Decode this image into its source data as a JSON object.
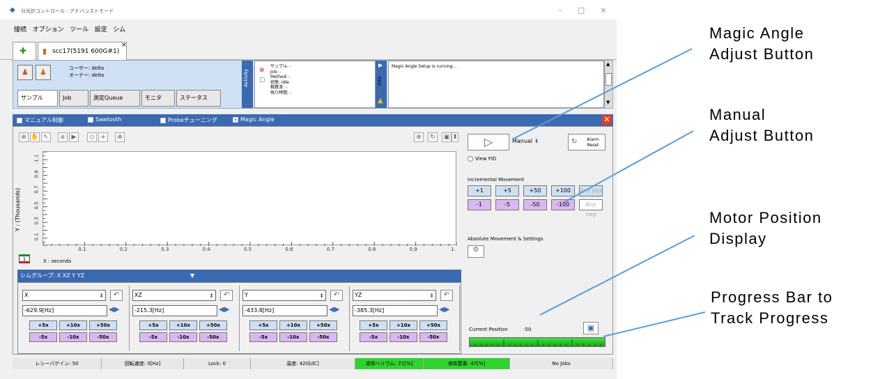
{
  "window": {
    "title": "分光計コントロール - アドバンストモード",
    "controls": [
      "–",
      "□",
      "×"
    ]
  },
  "menu": [
    "接続",
    "オプション",
    "ツール",
    "設定",
    "シム"
  ],
  "connection_tab": {
    "label": "scc17(5191 600G#1)",
    "close": "×"
  },
  "header": {
    "user_label": "ユーザー: delta",
    "owner_label": "オーナー: delta",
    "tabs": [
      "サンプル",
      "Job",
      "測定Queue",
      "モニタ",
      "ステータス"
    ],
    "activity_label": "Activity",
    "activity_lines": [
      "サンプル: -",
      "Job: -",
      "Method: -",
      "状態: Idle",
      "積算済: -",
      "残り時間: -"
    ],
    "info_label": "Info",
    "info_message": "Magic Angle Setup is running..."
  },
  "modes": [
    {
      "label": "マニュアル制御",
      "selected": false
    },
    {
      "label": "Sawtooth",
      "selected": false
    },
    {
      "label": "Probeチューニング",
      "selected": false
    },
    {
      "label": "Magic Angle",
      "selected": true
    }
  ],
  "chart_data": {
    "type": "line",
    "xlabel": "X : seconds",
    "ylabel": "Y : (Thousands)",
    "x_ticks": [
      "0.1",
      "0.2",
      "0.3",
      "0.4",
      "0.5",
      "0.6",
      "0.7",
      "0.8",
      "0.9",
      "1."
    ],
    "y_ticks": [
      "0.1",
      "0.3",
      "0.5",
      "0.7",
      "0.9",
      "1.1"
    ],
    "series": []
  },
  "layer_badge": "1",
  "shim_group": {
    "label": "シムグループ: X XZ Y YZ",
    "arrow": "▼"
  },
  "shims": [
    {
      "name": "X",
      "value": "-629.9[Hz]"
    },
    {
      "name": "XZ",
      "value": "-215.3[Hz]"
    },
    {
      "name": "Y",
      "value": "-433.8[Hz]"
    },
    {
      "name": "YZ",
      "value": "-385.3[Hz]"
    }
  ],
  "shim_buttons": {
    "plus": [
      "+5x",
      "+10x",
      "+50x"
    ],
    "minus": [
      "-5x",
      "-10x",
      "-50x"
    ]
  },
  "right_panel": {
    "mode_select": "Manual",
    "alarm_reset": [
      "Alarm",
      "Reset"
    ],
    "view_fid": "View FID",
    "incremental_label": "Incremental Movement",
    "plus_buttons": [
      "+1",
      "+5",
      "+50",
      "+100",
      "Any pos"
    ],
    "minus_buttons": [
      "-1",
      "-5",
      "-50",
      "-100",
      "Any neg"
    ],
    "absolute_label": "Absolute Movement & Settings",
    "current_position_label": "Current Position",
    "current_position_value": "-50",
    "progress": 1.0
  },
  "status": [
    {
      "text": "レシーバゲイン: 50",
      "color": ""
    },
    {
      "text": "回転速度: 0[Hz]",
      "color": ""
    },
    {
      "text": "Lock: 0",
      "color": ""
    },
    {
      "text": "温度: 420[dC]",
      "color": ""
    },
    {
      "text": "液体ヘリウム: 71[%]",
      "color": "#32d132"
    },
    {
      "text": "液体窒素: 47[%]",
      "color": "#32d132"
    },
    {
      "text": "No Jobs",
      "color": ""
    }
  ],
  "annotations": {
    "magic_angle": [
      "Magic Angle",
      "Adjust Button"
    ],
    "manual": [
      "Manual",
      "Adjust Button"
    ],
    "motor": [
      "Motor Position",
      "Display"
    ],
    "progress": [
      "Progress Bar to",
      "Track Progress"
    ]
  },
  "colors": {
    "accent": "#3b6ab0",
    "annotation_line": "#5b9bd5",
    "progress": "#32d132",
    "close": "#e04020"
  }
}
